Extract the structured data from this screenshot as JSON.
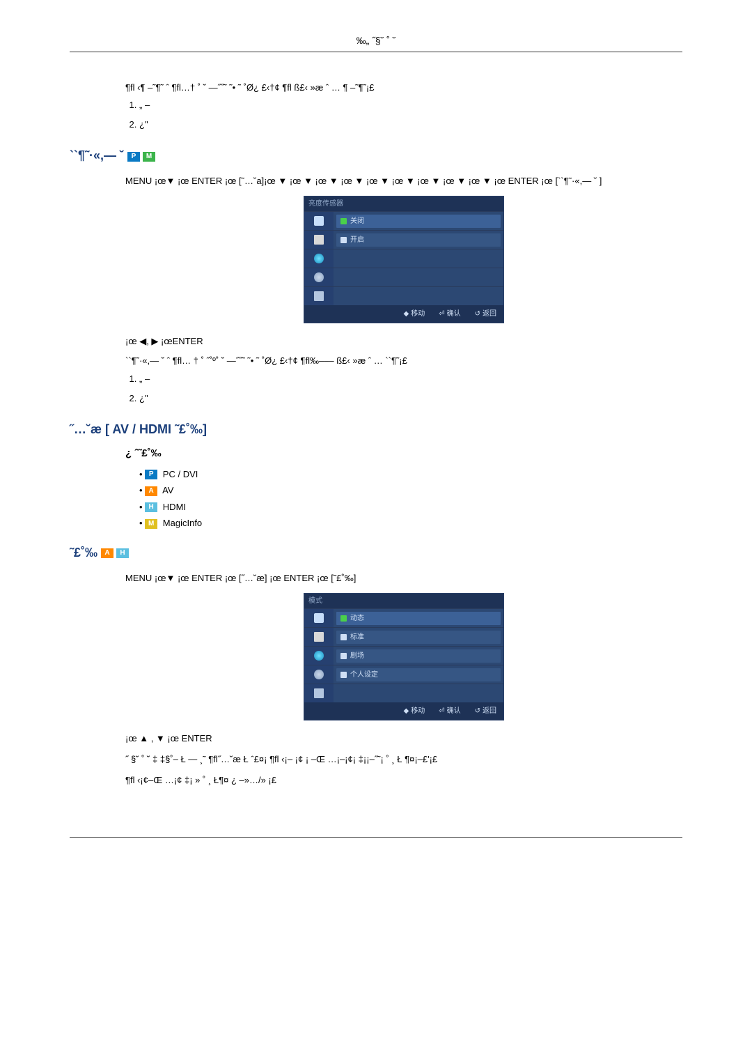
{
  "header": {
    "title": "‰„ ˝§˘ ˚ ˘"
  },
  "section1": {
    "intro": "¶ﬂ ‹¶ –˜¶˜ ˆ    ¶ﬂ…† ˚ ˘ —˝˝˜ ˜• ˜ ˚Ø¿ £‹†¢ ¶ﬂ   ß£‹ »æ ˆ … ¶ –˜¶˜¡£",
    "items": [
      "„ –",
      "¿\""
    ],
    "heading": "``¶˜·«,— ˘",
    "menu_path": "MENU ¡œ▼ ¡œ ENTER ¡œ [˜…˘a]¡œ  ▼ ¡œ ▼ ¡œ ▼ ¡œ ▼ ¡œ ▼ ¡œ ▼ ¡œ ▼ ¡œ ▼ ¡œ ▼ ¡œ ENTER ¡œ [``¶˜·«,— ˘ ]",
    "osd_title": "亮度传感器",
    "osd_options": [
      "关闭",
      "开启"
    ],
    "osd_footer": [
      "移动",
      "确认",
      "返回"
    ],
    "after_nav": "¡œ ◀, ▶ ¡œENTER",
    "after_para": "``¶˜·«,— ˘ ˆ    ¶ﬂ… † ˚ ˝˚º˚ ˘ —˝˝˜ ˜• ˜ ˚Ø¿ £‹†¢ ¶ﬂ‰–––    ß£‹ »æ ˆ … ``¶˜¡£",
    "items2": [
      "„ –",
      "¿\""
    ]
  },
  "section2": {
    "heading": "˝…˘æ [ AV / HDMI ˜£˚‰]",
    "sub": "¿ ˆ˜£˚‰",
    "sources": {
      "pcdvi": "PC / DVI",
      "av": "AV",
      "hdmi": "HDMI",
      "magicinfo": "MagicInfo"
    }
  },
  "section3": {
    "heading": "˜£˚‰",
    "menu_path": "MENU ¡œ▼ ¡œ ENTER ¡œ [˝…˘æ] ¡œ ENTER ¡œ [˜£˚‰]",
    "osd_title": "模式",
    "osd_options": [
      "动态",
      "标准",
      "剧场",
      "个人设定"
    ],
    "osd_footer": [
      "移动",
      "确认",
      "返回"
    ],
    "after_nav": "¡œ ▲ ,   ▼ ¡œ ENTER",
    "para1": "˝ §˘ ˚ ˘   ‡ ‡§˚– Ł — ¸˜   ¶ﬂ˝…˘æ Ł ˆ£¤¡        ¶ﬂ ‹¡– ¡¢ ¡  –Œ …¡–¡¢¡  ‡¡¡–˝˜¡     ˚ ¸ Ł ¶¤¡–£'¡£",
    "para2": "¶ﬂ ‹¡¢–Œ …¡¢  ‡¡ » ˚ ¸ Ł¶¤ ¿ –»…/» ¡£"
  }
}
